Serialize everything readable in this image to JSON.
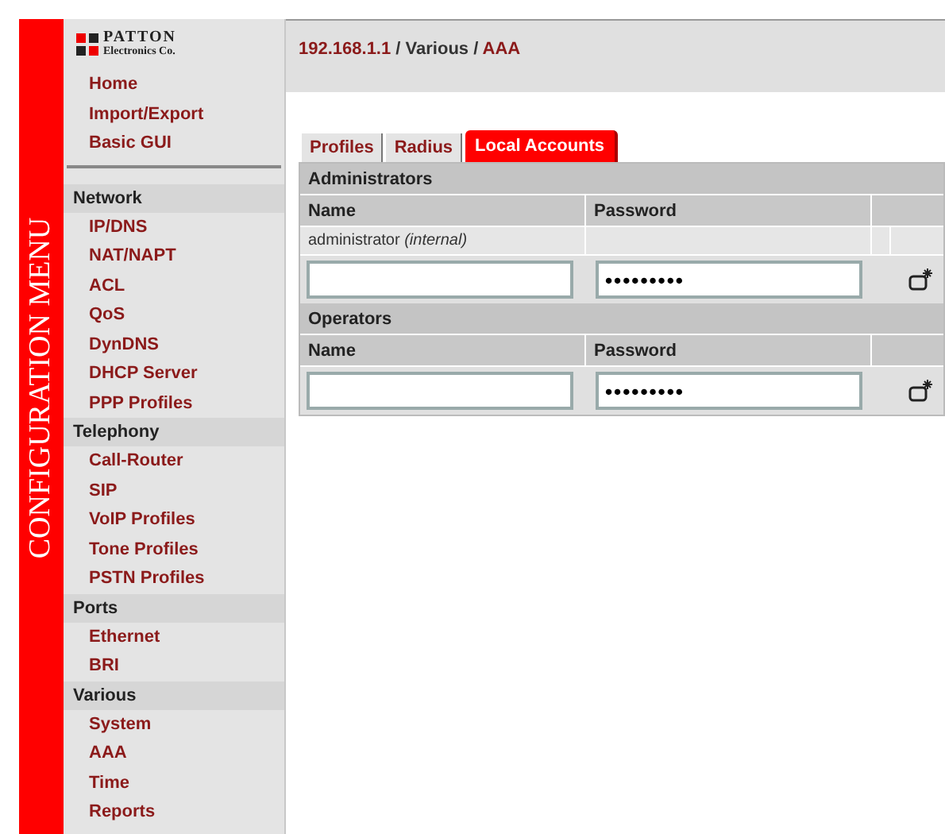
{
  "side_title": "CONFIGURATION MENU",
  "logo": {
    "name": "PATTON",
    "subtitle": "Electronics Co."
  },
  "menu": [
    {
      "items": [
        "Home",
        "Import/Export",
        "Basic GUI"
      ]
    },
    {
      "heading": "Network",
      "items": [
        "IP/DNS",
        "NAT/NAPT",
        "ACL",
        "QoS",
        "DynDNS",
        "DHCP Server",
        "PPP Profiles"
      ]
    },
    {
      "heading": "Telephony",
      "items": [
        "Call-Router",
        "SIP",
        "VoIP Profiles",
        "Tone Profiles",
        "PSTN Profiles"
      ]
    },
    {
      "heading": "Ports",
      "items": [
        "Ethernet",
        "BRI"
      ]
    },
    {
      "heading": "Various",
      "items": [
        "System",
        "AAA",
        "Time",
        "Reports"
      ]
    }
  ],
  "breadcrumb": [
    {
      "kind": "link",
      "text": "192.168.1.1"
    },
    {
      "kind": "text",
      "text": " / Various / "
    },
    {
      "kind": "link",
      "text": "AAA"
    }
  ],
  "tabs": [
    {
      "label": "Profiles",
      "selected": false
    },
    {
      "label": "Radius",
      "selected": false
    },
    {
      "label": "Local Accounts",
      "selected": true
    }
  ],
  "sections": [
    {
      "title": "Administrators",
      "columns": [
        "Name",
        "Password"
      ],
      "entries": [
        "administrator *(internal)*"
      ],
      "new_row": {
        "password": "•••••••••"
      }
    },
    {
      "title": "Operators",
      "columns": [
        "Name",
        "Password"
      ],
      "new_row": {
        "password": "•••••••••"
      }
    }
  ]
}
